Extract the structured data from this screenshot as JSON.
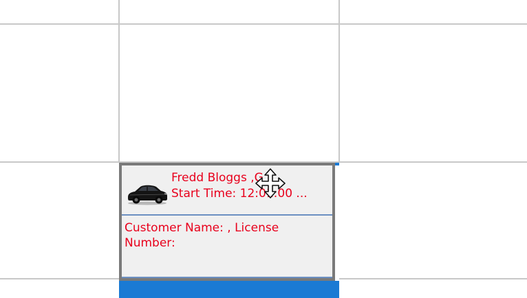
{
  "scheduler": {
    "booking": {
      "title": "Fredd Bloggs ,G",
      "start_time": "Start Time: 12:01:00 ...",
      "details": "Customer Name: , License Number:",
      "icon": "car-icon",
      "text_color": "#e8001c",
      "footer_color": "#1a7ad4",
      "frame_color": "#7a7a7a"
    },
    "cursor": "move-cursor-icon",
    "grid_color": "#c8c8c8"
  }
}
